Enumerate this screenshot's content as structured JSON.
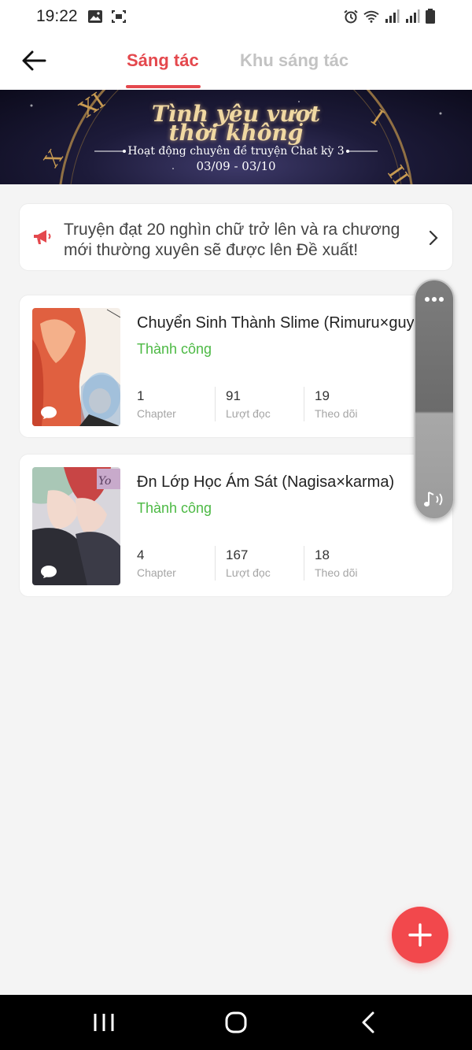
{
  "status_bar": {
    "time": "19:22",
    "left_icons": [
      "image-icon",
      "screenshot-icon"
    ],
    "right_icons": [
      "alarm-icon",
      "wifi-icon",
      "signal-icon",
      "signal-icon",
      "battery-icon"
    ]
  },
  "header": {
    "back_icon": "arrow-left-icon",
    "tabs": [
      {
        "label": "Sáng tác",
        "active": true
      },
      {
        "label": "Khu sáng tác",
        "active": false
      }
    ]
  },
  "banner": {
    "title_line1": "Tình yêu vượt",
    "title_line2": "thời không",
    "subtitle": "Hoạt động chuyên đề truyện Chat kỳ 3",
    "date_range": "03/09 - 03/10"
  },
  "notice": {
    "icon": "megaphone-icon",
    "text": "Truyện đạt 20 nghìn chữ trở lên và ra chương mới thường xuyên sẽ được lên Đề xuất!"
  },
  "stories": [
    {
      "title": "Chuyển Sinh Thành Slime (Rimuru×guy)",
      "status": "Thành công",
      "stats": [
        {
          "value": "1",
          "label": "Chapter"
        },
        {
          "value": "91",
          "label": "Lượt đọc"
        },
        {
          "value": "19",
          "label": "Theo dõi"
        }
      ]
    },
    {
      "title": "Đn Lớp Học Ám Sát (Nagisa×karma)",
      "status": "Thành công",
      "stats": [
        {
          "value": "4",
          "label": "Chapter"
        },
        {
          "value": "167",
          "label": "Lượt đọc"
        },
        {
          "value": "18",
          "label": "Theo dõi"
        }
      ]
    }
  ],
  "colors": {
    "accent": "#e4484d",
    "success": "#4cb944",
    "fab": "#f2484c",
    "background": "#f4f4f4"
  }
}
